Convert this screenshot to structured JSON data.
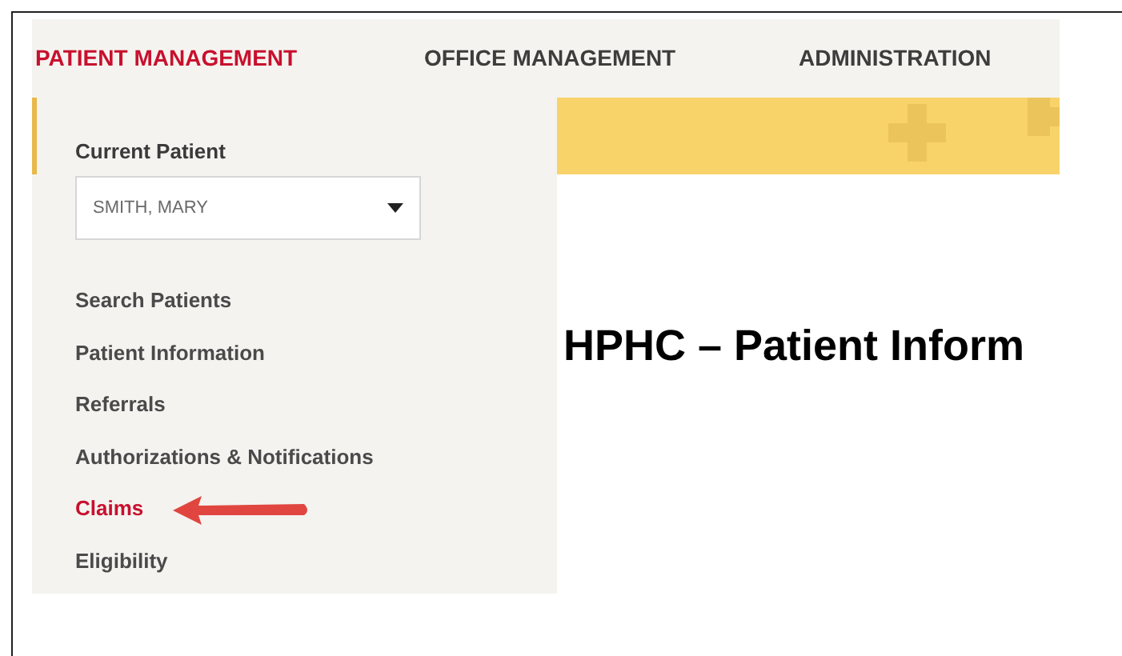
{
  "nav_tabs": [
    {
      "label": "PATIENT MANAGEMENT",
      "selected": true
    },
    {
      "label": "OFFICE MANAGEMENT",
      "selected": false
    },
    {
      "label": "ADMINISTRATION",
      "selected": false
    }
  ],
  "dropdown": {
    "current_patient_label": "Current Patient",
    "patient_select": {
      "value": "SMITH, MARY"
    },
    "items": [
      {
        "label": "Search Patients",
        "selected": false
      },
      {
        "label": "Patient Information",
        "selected": false
      },
      {
        "label": "Referrals",
        "selected": false
      },
      {
        "label": "Authorizations & Notifications",
        "selected": false
      },
      {
        "label": "Claims",
        "selected": true
      },
      {
        "label": "Eligibility",
        "selected": false
      }
    ]
  },
  "page_title": "HPHC – Patient Inform"
}
